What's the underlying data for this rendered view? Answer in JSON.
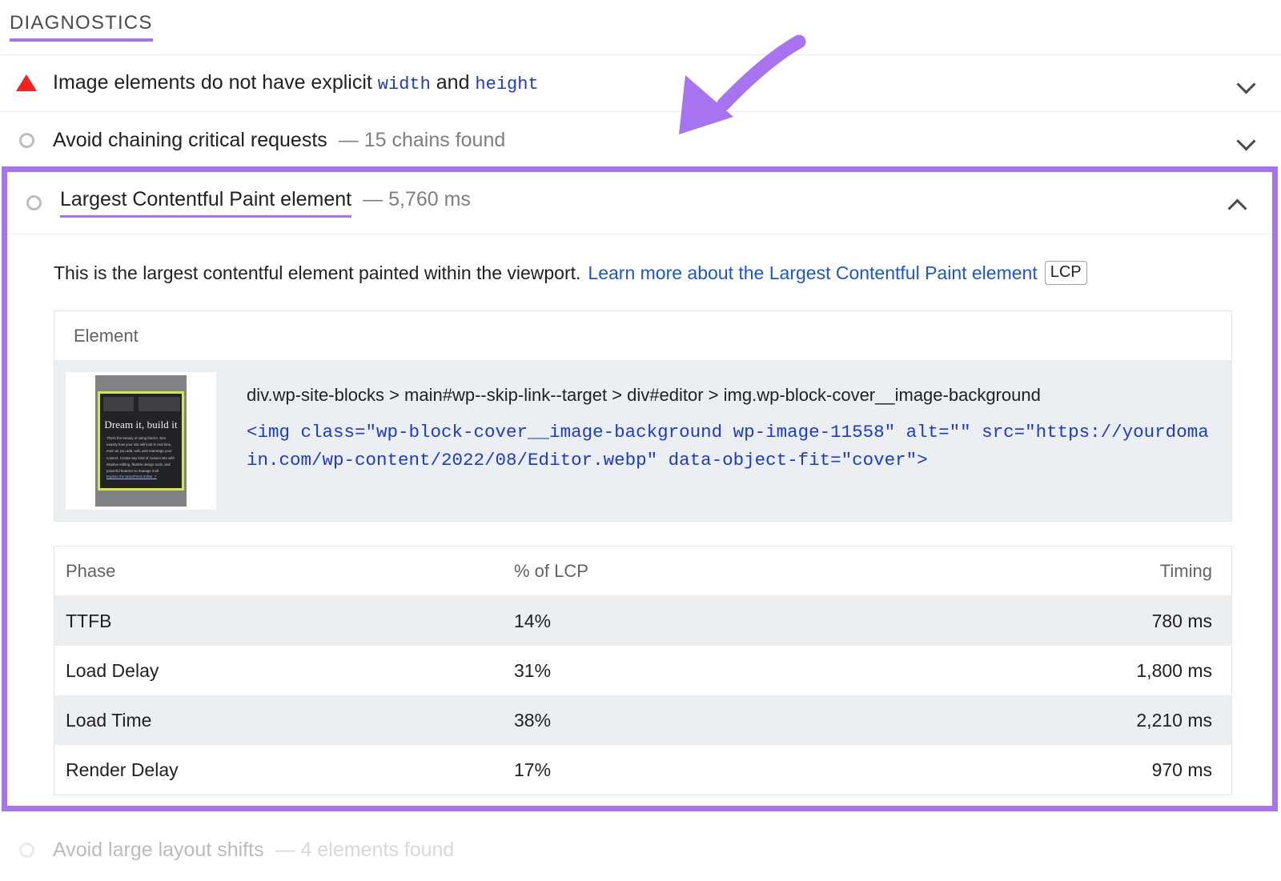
{
  "section": {
    "heading": "DIAGNOSTICS"
  },
  "audits": [
    {
      "icon": "warning-triangle",
      "title_prefix": "Image elements do not have explicit ",
      "code_1": "width",
      "title_mid": " and ",
      "code_2": "height",
      "subtitle": "",
      "chevron": "chevron-down"
    },
    {
      "icon": "circle-outline",
      "title": "Avoid chaining critical requests",
      "subtitle": "— 15 chains found",
      "chevron": "chevron-down"
    },
    {
      "icon": "circle-outline",
      "title": "Avoid large layout shifts",
      "subtitle": "— 4 elements found",
      "chevron": "chevron-down"
    }
  ],
  "lcp": {
    "icon": "circle-outline",
    "title": "Largest Contentful Paint element",
    "value": "— 5,760 ms",
    "chevron": "chevron-up",
    "description": "This is the largest contentful element painted within the viewport.",
    "learn_more": "Learn more about the Largest Contentful Paint element",
    "badge": "LCP",
    "element_table": {
      "header": "Element",
      "selector_path": "div.wp-site-blocks > main#wp--skip-link--target > div#editor > img.wp-block-cover__image-background",
      "snippet_line_1": "<img class=\"wp-block-cover__image-background wp-image-11558\" alt=\"\" src=\"https://yourdomain.com",
      "snippet_line_2": "/wp-content/2022/08/Editor.webp\" data-object-fit=\"cover\">",
      "thumbnail": {
        "heading": "Dream it, build it",
        "body": "That's the beauty of using blocks. See exactly how your site will look in real time, even as you add, edit, and rearrange your content. Create any kind of custom site with intuitive editing, flexible design tools, and powerful features to manage it all.",
        "link": "Explore the WordPress Editor ↗"
      }
    },
    "phase_table": {
      "columns": [
        "Phase",
        "% of LCP",
        "Timing"
      ],
      "rows": [
        {
          "phase": "TTFB",
          "pct": "14%",
          "timing": "780 ms"
        },
        {
          "phase": "Load Delay",
          "pct": "31%",
          "timing": "1,800 ms"
        },
        {
          "phase": "Load Time",
          "pct": "38%",
          "timing": "2,210 ms"
        },
        {
          "phase": "Render Delay",
          "pct": "17%",
          "timing": "970 ms"
        }
      ]
    }
  },
  "annotation": {
    "arrow": "curved-arrow-pointing-down-left",
    "color": "#a873f0"
  },
  "colors": {
    "highlight_purple": "#a873f0",
    "warning_red": "#f42121",
    "code_blue": "#1a3ad6",
    "link_blue": "#1a56d6",
    "row_stripe": "#eceff1"
  }
}
